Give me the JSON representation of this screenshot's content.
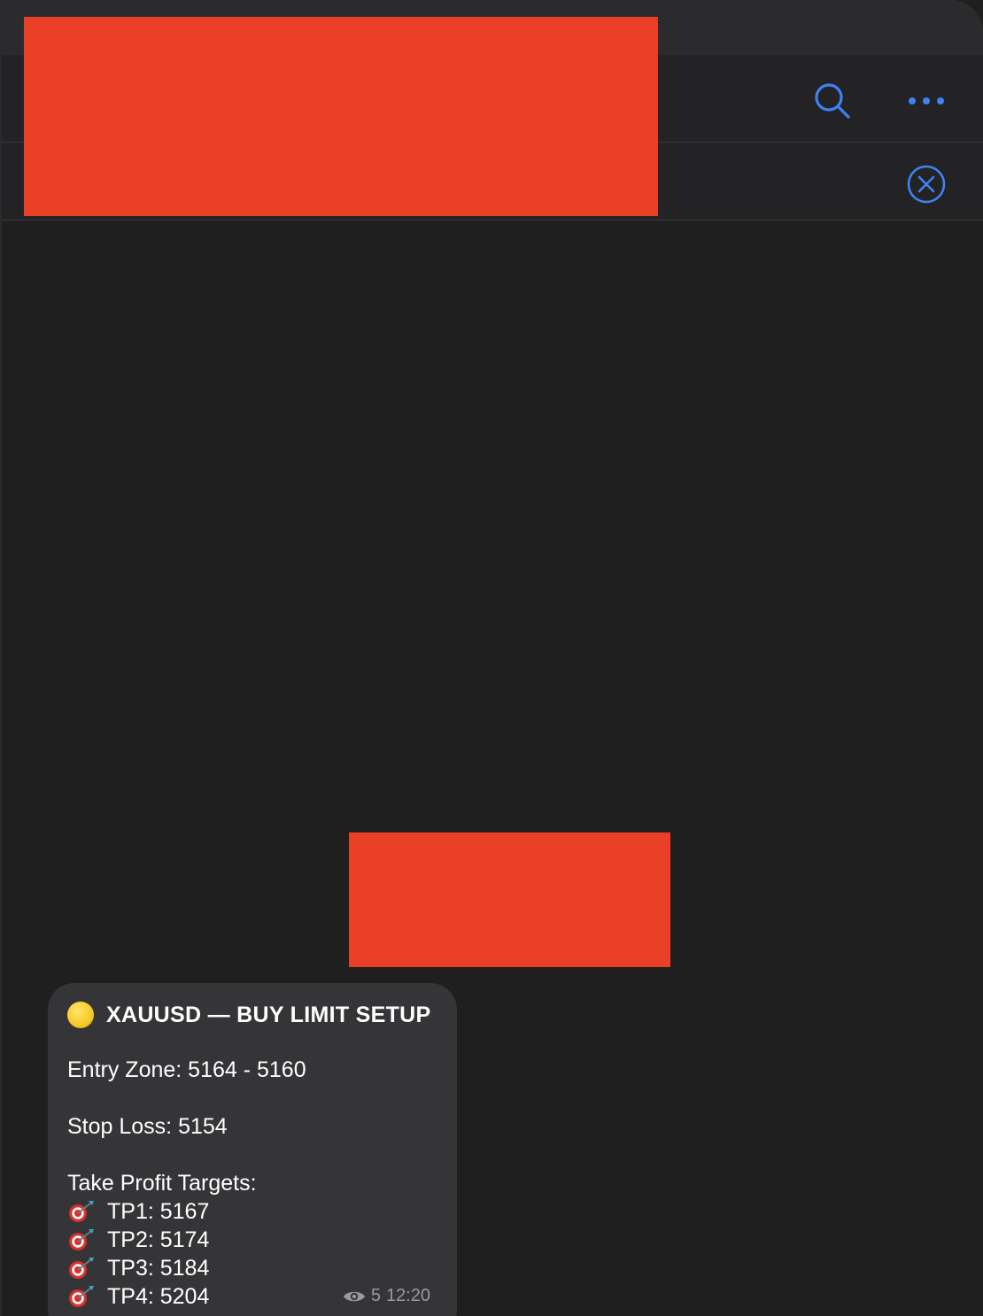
{
  "colors": {
    "accent": "#3d82f5",
    "redaction": "#e93f27",
    "bubble": "#353538",
    "background": "#1f1f1f"
  },
  "header": {
    "search_icon": "search-icon",
    "more_icon": "more-horizontal-icon"
  },
  "pinned": {
    "close_icon": "close-circle-icon"
  },
  "message": {
    "title": "XAUUSD — BUY LIMIT SETUP",
    "entry": "Entry Zone: 5164 - 5160",
    "stop": "Stop Loss: 5154",
    "targets_label": "Take Profit Targets:",
    "targets": [
      "TP1: 5167",
      "TP2: 5174",
      "TP3: 5184",
      "TP4: 5204"
    ],
    "views": "5",
    "time": "12:20"
  }
}
